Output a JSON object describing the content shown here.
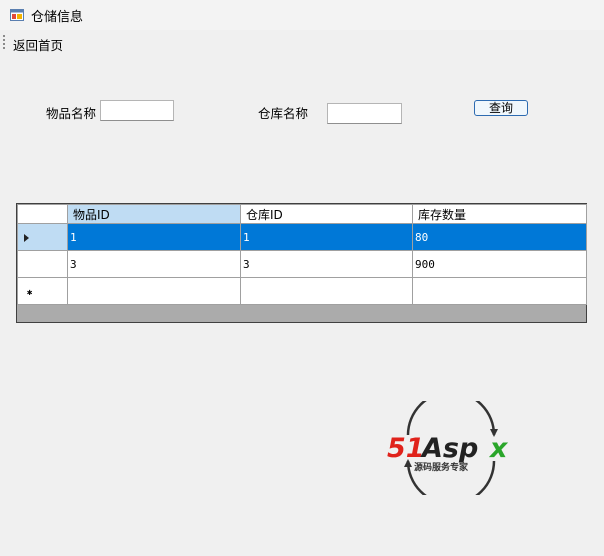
{
  "window": {
    "title": "仓储信息",
    "icon": "window-form-icon"
  },
  "menu": {
    "home_label": "返回首页"
  },
  "search": {
    "item_name_label": "物品名称",
    "item_name_value": "",
    "warehouse_name_label": "仓库名称",
    "warehouse_name_value": "",
    "query_button": "查询"
  },
  "grid": {
    "columns": [
      "物品ID",
      "仓库ID",
      "库存数量"
    ],
    "rows": [
      {
        "cells": [
          "1",
          "1",
          "80"
        ],
        "selected": true
      },
      {
        "cells": [
          "3",
          "3",
          "900"
        ],
        "selected": false
      }
    ],
    "colors": {
      "selection": "#0078d7",
      "header_highlight": "#bfdcf3",
      "empty_area": "#ababab"
    }
  },
  "watermark": {
    "brand": "51Aspx",
    "tagline": "源码服务专家",
    "colors": {
      "primary": "#e0221b",
      "accent": "#2aa62a"
    }
  }
}
